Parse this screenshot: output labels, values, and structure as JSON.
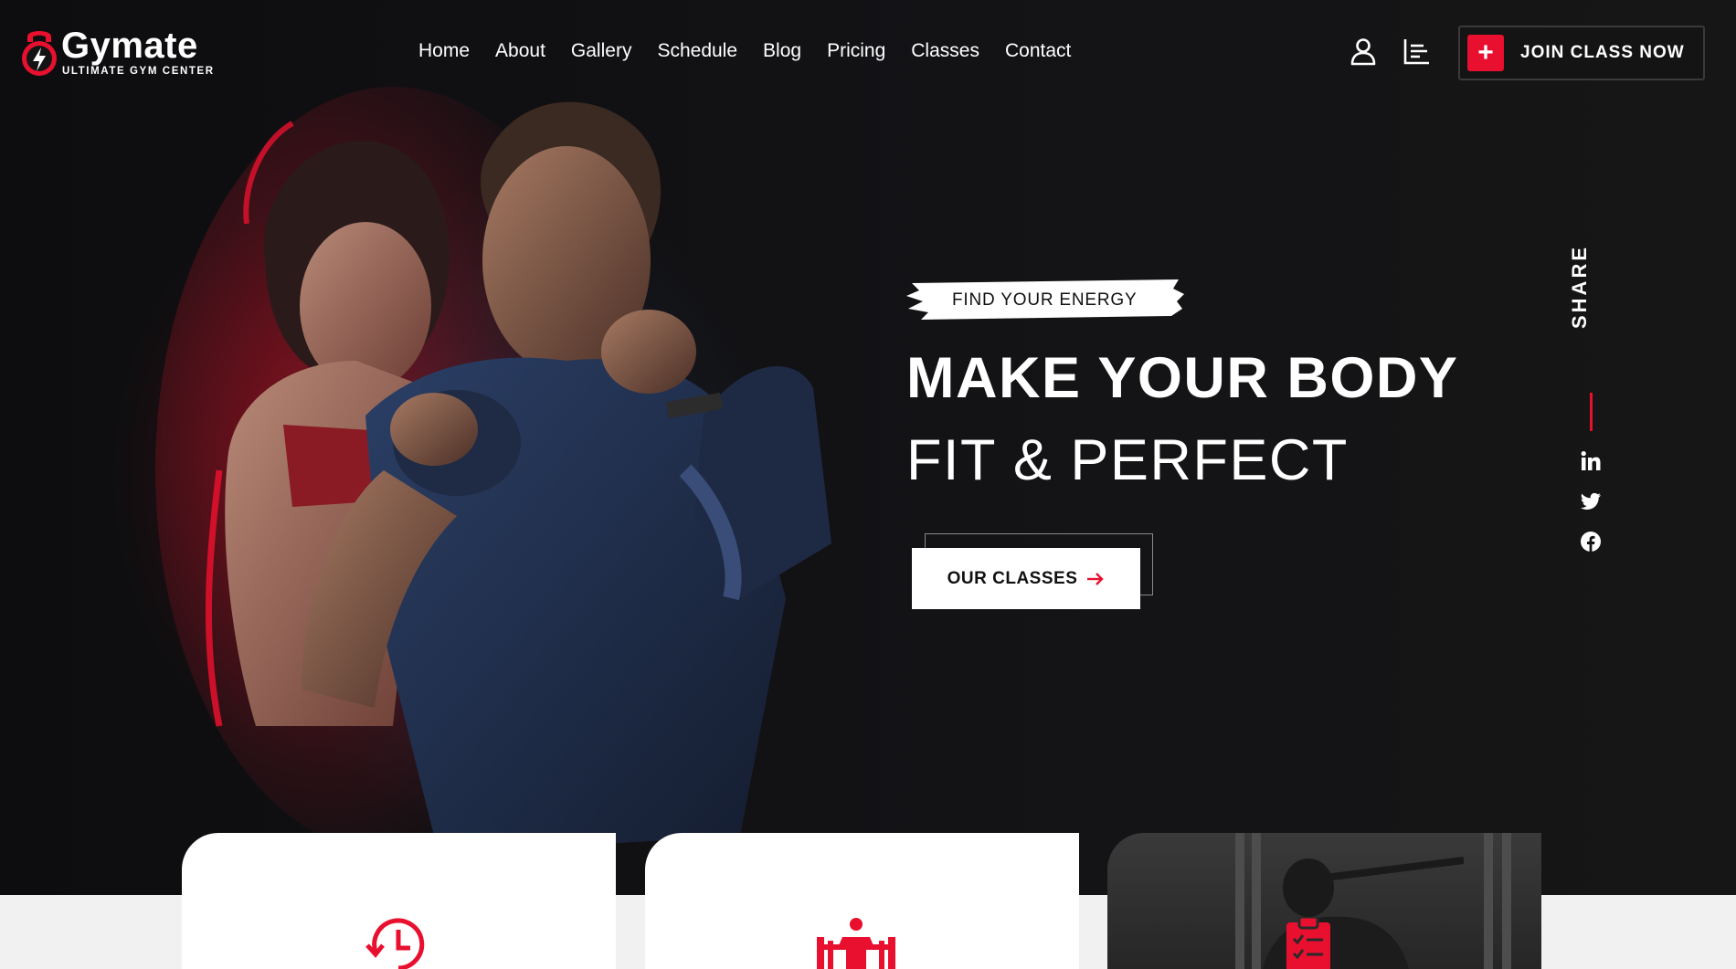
{
  "brand": {
    "name": "Gymate",
    "tagline": "ULTIMATE GYM CENTER",
    "accent_color": "#e8102e"
  },
  "nav": {
    "items": [
      "Home",
      "About",
      "Gallery",
      "Schedule",
      "Blog",
      "Pricing",
      "Classes",
      "Contact"
    ]
  },
  "header_actions": {
    "account_icon": "user-icon",
    "menu_icon": "sidebar-menu-icon",
    "join_label": "JOIN CLASS NOW",
    "join_icon": "plus-icon"
  },
  "hero": {
    "tagline": "FIND YOUR ENERGY",
    "headline_bold": "MAKE YOUR BODY",
    "headline_light": "FIT & PERFECT",
    "cta_label": "OUR CLASSES",
    "cta_icon": "arrow-right-icon"
  },
  "share": {
    "label": "SHARE",
    "networks": [
      "linkedin-icon",
      "twitter-icon",
      "facebook-icon"
    ]
  },
  "feature_cards": [
    {
      "icon": "clock-history-icon"
    },
    {
      "icon": "weightlifter-icon"
    },
    {
      "icon": "clipboard-checklist-icon"
    }
  ]
}
